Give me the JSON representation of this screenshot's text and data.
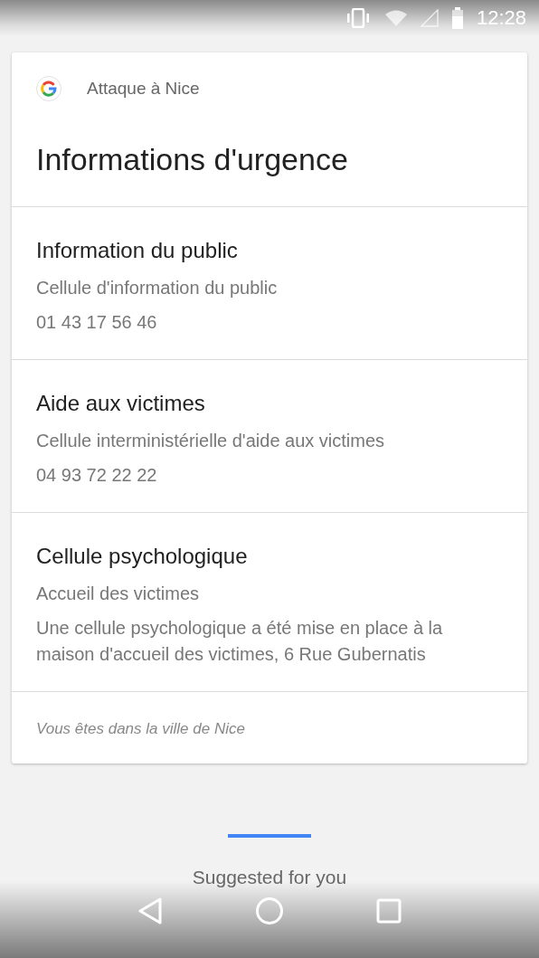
{
  "status_bar": {
    "time": "12:28"
  },
  "card": {
    "source": "Attaque à Nice",
    "title": "Informations d'urgence",
    "sections": [
      {
        "title": "Information du public",
        "lines": [
          "Cellule d'information du public",
          "01 43 17 56 46"
        ]
      },
      {
        "title": "Aide aux victimes",
        "lines": [
          "Cellule interministérielle d'aide aux victimes",
          "04 93 72 22 22"
        ]
      },
      {
        "title": "Cellule psychologique",
        "lines": [
          "Accueil des victimes",
          "Une cellule psychologique a été mise en place à la maison d'accueil des victimes, 6 Rue Gubernatis"
        ]
      }
    ],
    "footer": "Vous êtes dans la ville de Nice"
  },
  "suggested": {
    "label": "Suggested for you"
  }
}
